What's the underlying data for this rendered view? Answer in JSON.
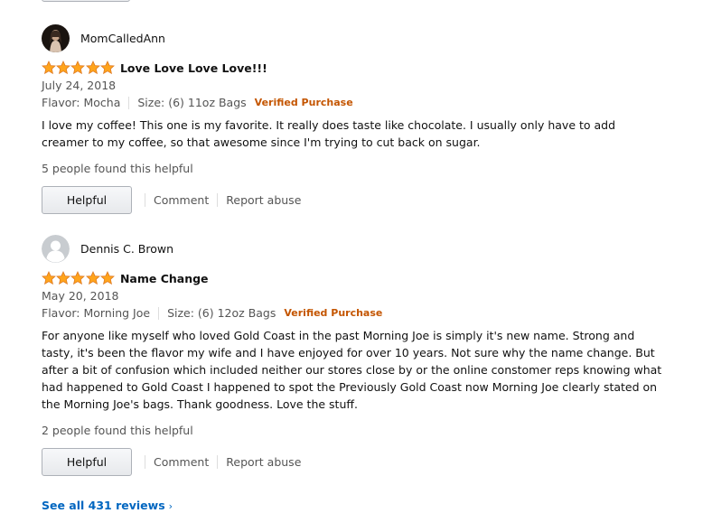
{
  "reviews": [
    {
      "profile_name": "MomCalledAnn",
      "rating": 5,
      "title": "Love Love Love Love!!!",
      "date": "July 24, 2018",
      "flavor": "Flavor: Mocha",
      "size": "Size: (6) 11oz Bags",
      "verified": "Verified Purchase",
      "body": "I love my coffee! This one is my favorite. It really does taste like chocolate. I usually only have to add creamer to my coffee, so that awesome since I'm trying to cut back on sugar.",
      "helpful_count": "5 people found this helpful",
      "helpful_label": "Helpful",
      "comment_label": "Comment",
      "report_label": "Report abuse"
    },
    {
      "profile_name": "Dennis C. Brown",
      "rating": 5,
      "title": "Name Change",
      "date": "May 20, 2018",
      "flavor": "Flavor: Morning Joe",
      "size": "Size: (6) 12oz Bags",
      "verified": "Verified Purchase",
      "body": "For anyone like myself who loved Gold Coast in the past Morning Joe is simply it's new name. Strong and tasty, it's been the flavor my wife and I have enjoyed for over 10 years. Not sure why the name change. But after a bit of confusion which included neither our stores close by or the online constomer reps knowing what had happened to Gold Coast I happened to spot the Previously Gold Coast now Morning Joe clearly stated on the Morning Joe's bags. Thank goodness. Love the stuff.",
      "helpful_count": "2 people found this helpful",
      "helpful_label": "Helpful",
      "comment_label": "Comment",
      "report_label": "Report abuse"
    }
  ],
  "see_all": "See all 431 reviews",
  "see_all_chevron": "›",
  "colors": {
    "star_fill": "#ffa41c",
    "star_stroke": "#de7921",
    "verified": "#c45500",
    "link": "#0066c0"
  }
}
